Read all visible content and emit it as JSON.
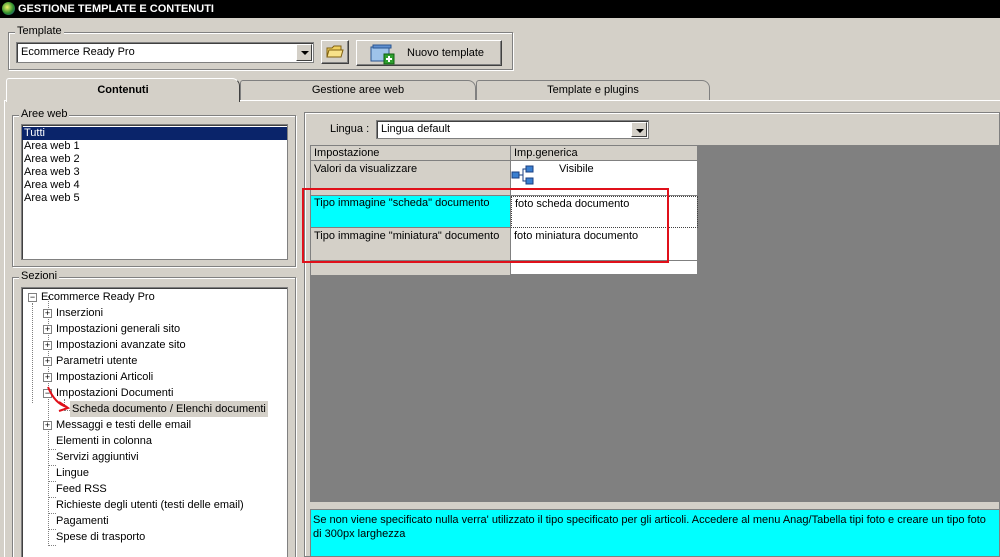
{
  "window": {
    "title": "GESTIONE TEMPLATE E CONTENUTI"
  },
  "template": {
    "group_label": "Template",
    "selected": "Ecommerce Ready Pro",
    "new_button_label": "Nuovo template"
  },
  "tabs": [
    {
      "label": "Contenuti",
      "active": true
    },
    {
      "label": "Gestione aree web",
      "active": false
    },
    {
      "label": "Template e plugins",
      "active": false
    }
  ],
  "aree_web": {
    "group_label": "Aree web",
    "items": [
      "Tutti",
      "Area web 1",
      "Area web 2",
      "Area web 3",
      "Area web 4",
      "Area web 5"
    ],
    "selected": "Tutti"
  },
  "sezioni": {
    "group_label": "Sezioni",
    "root": "Ecommerce Ready Pro",
    "nodes": [
      {
        "label": "Inserzioni",
        "expandable": true
      },
      {
        "label": "Impostazioni generali sito",
        "expandable": true
      },
      {
        "label": "Impostazioni avanzate sito",
        "expandable": true
      },
      {
        "label": "Parametri utente",
        "expandable": true
      },
      {
        "label": "Impostazioni Articoli",
        "expandable": true
      },
      {
        "label": "Impostazioni Documenti",
        "expandable": true,
        "expanded": true
      },
      {
        "label": "Scheda documento / Elenchi documenti",
        "child": true,
        "selected": true
      },
      {
        "label": "Messaggi e testi delle email",
        "expandable": true
      },
      {
        "label": "Elementi in colonna",
        "expandable": false
      },
      {
        "label": "Servizi aggiuntivi",
        "expandable": false
      },
      {
        "label": "Lingue",
        "expandable": false
      },
      {
        "label": "Feed RSS",
        "expandable": false
      },
      {
        "label": "Richieste degli utenti (testi delle email)",
        "expandable": false
      },
      {
        "label": "Pagamenti",
        "expandable": false
      },
      {
        "label": "Spese di trasporto",
        "expandable": false
      }
    ]
  },
  "lingua": {
    "label": "Lingua :",
    "selected": "Lingua default"
  },
  "grid": {
    "headers": [
      "Impostazione",
      "Imp.generica"
    ],
    "rows": [
      {
        "setting": "Valori da visualizzare",
        "value": "Visibile",
        "has_icon": true
      },
      {
        "setting": "Tipo immagine \"scheda\" documento",
        "value": "foto scheda documento",
        "highlighted": true
      },
      {
        "setting": "Tipo immagine \"miniatura\" documento",
        "value": "foto miniatura documento"
      }
    ]
  },
  "help_text": "Se non viene specificato nulla verra' utilizzato il tipo specificato per gli articoli. Accedere al menu Anag/Tabella tipi foto e creare un tipo foto di 300px larghezza",
  "colors": {
    "title_bg": "#000000",
    "selection": "#0a246a",
    "highlight_cyan": "#00ffff",
    "annotation_red": "#e0101a"
  }
}
